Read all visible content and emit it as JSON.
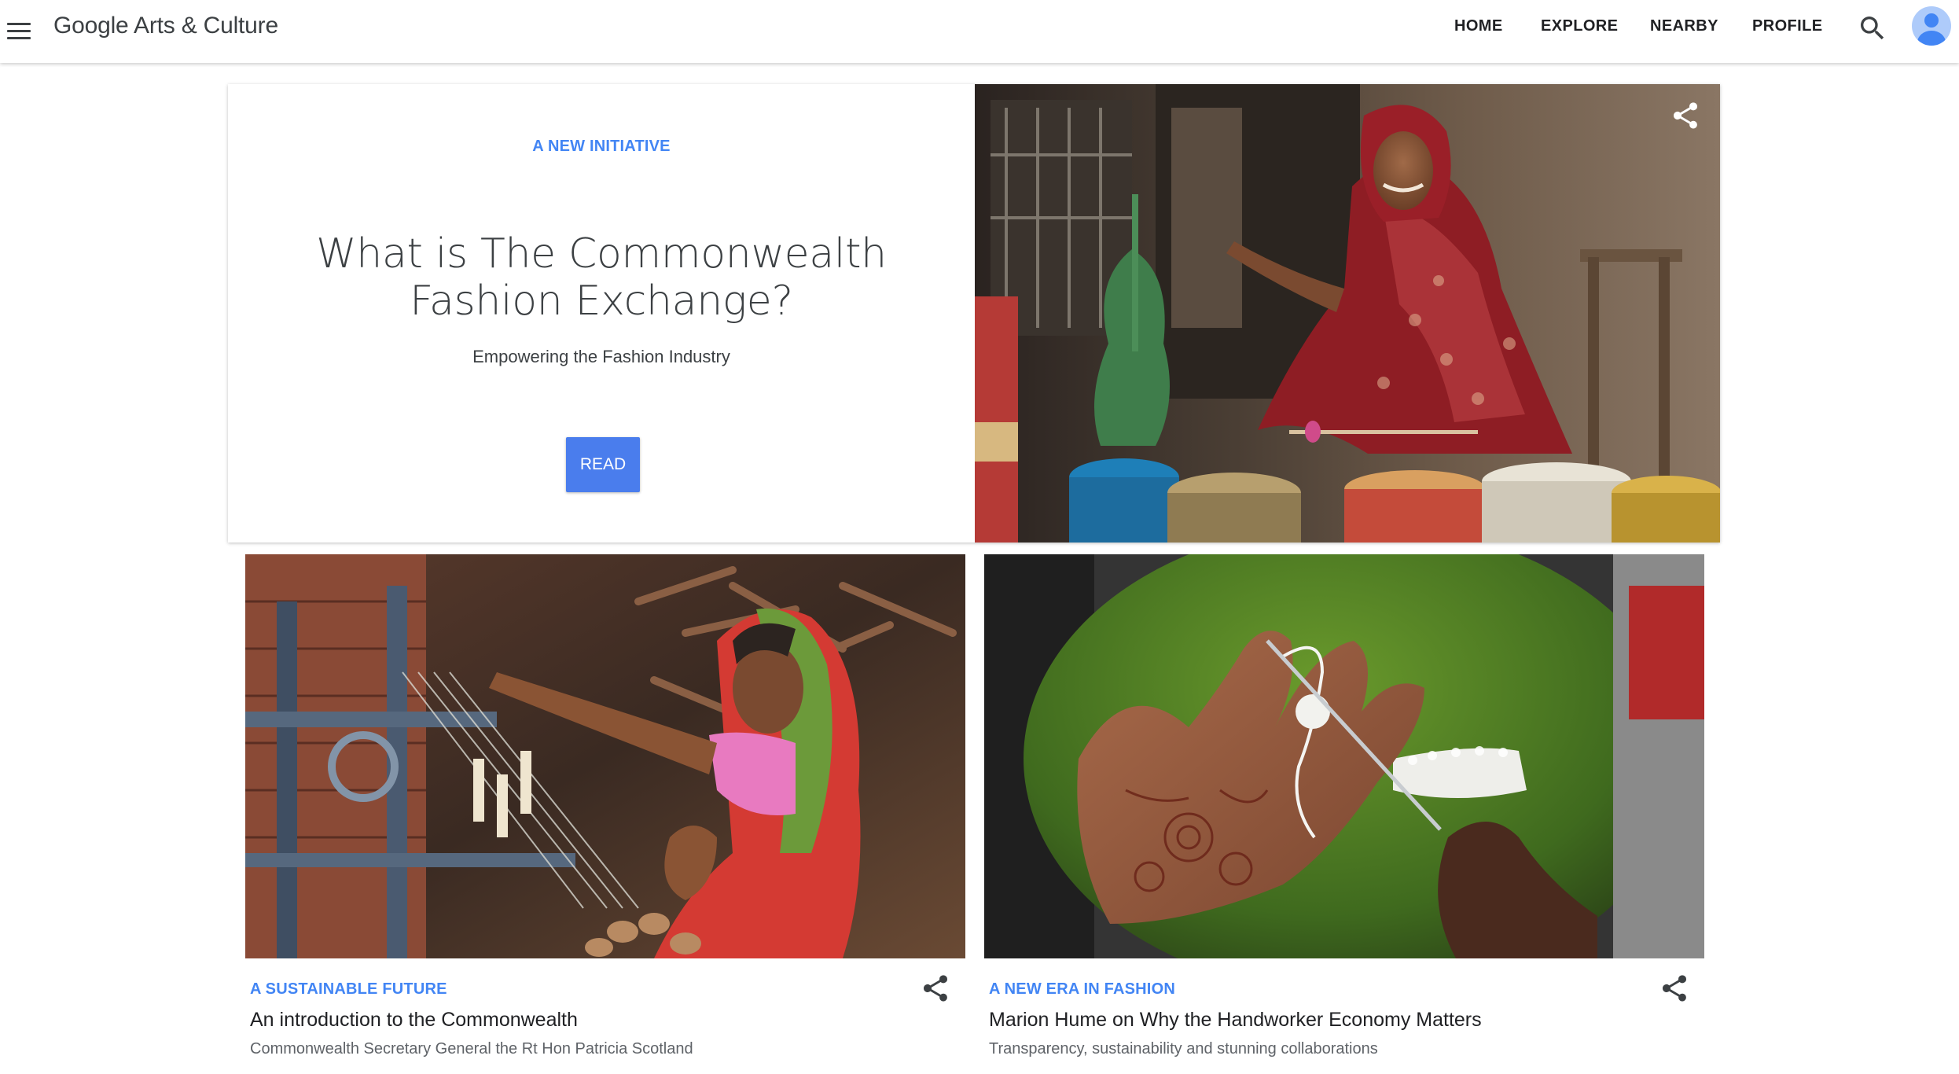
{
  "app": {
    "brand": "Google Arts & Culture"
  },
  "nav": {
    "home": "HOME",
    "explore": "EXPLORE",
    "nearby": "NEARBY",
    "profile": "PROFILE"
  },
  "icons": {
    "menu": "hamburger-menu-icon",
    "search": "search-icon",
    "share": "share-icon",
    "avatar": "user-avatar"
  },
  "colors": {
    "accent": "#4285f4",
    "button": "#4a7ded"
  },
  "hero": {
    "eyebrow": "A NEW INITIATIVE",
    "title": "What is The Commonwealth Fashion Exchange?",
    "subtitle": "Empowering the Fashion Industry",
    "button": "READ"
  },
  "cards": [
    {
      "eyebrow": "A SUSTAINABLE FUTURE",
      "title": "An introduction to the Commonwealth",
      "description": "Commonwealth Secretary General the Rt Hon Patricia Scotland"
    },
    {
      "eyebrow": "A NEW ERA IN FASHION",
      "title": "Marion Hume on Why the Handworker Economy Matters",
      "description": "Transparency, sustainability and stunning collaborations"
    }
  ]
}
